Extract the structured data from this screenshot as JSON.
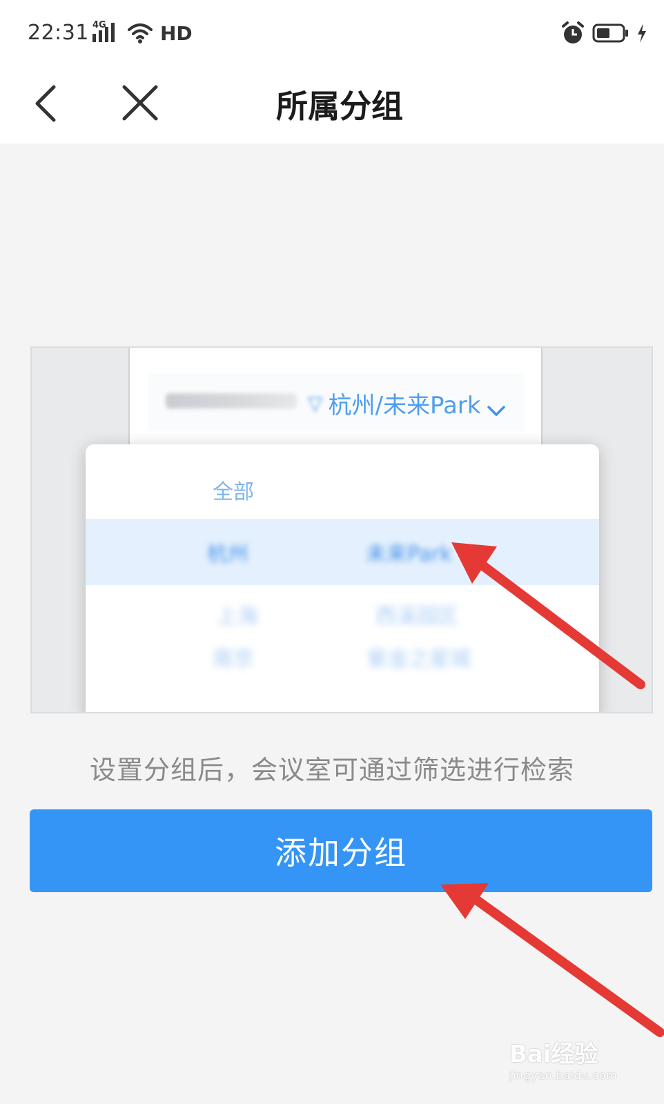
{
  "status_bar": {
    "time": "22:31",
    "network": "4G",
    "hd": "HD",
    "icons": [
      "signal-icon",
      "wifi-icon",
      "alarm-icon",
      "battery-icon",
      "charging-icon"
    ]
  },
  "header": {
    "title": "所属分组",
    "back_icon": "chevron-left-icon",
    "close_icon": "close-icon"
  },
  "illustration": {
    "filter_text": "杭州/未来Park",
    "dropdown": {
      "rows": [
        {
          "left": "全部",
          "right": ""
        },
        {
          "left": "杭州",
          "right": "未来Park"
        },
        {
          "left": "上海",
          "right": "西溪园区"
        },
        {
          "left": "南京",
          "right": "紫金之星城"
        }
      ]
    }
  },
  "hint": "设置分组后，会议室可通过筛选进行检索",
  "primary_button": {
    "label": "添加分组"
  },
  "watermark": {
    "logo": "Bai经验",
    "url": "jingyan.baidu.com"
  },
  "colors": {
    "primary": "#3595f6",
    "arrow": "#e53935",
    "background": "#f4f4f4"
  }
}
